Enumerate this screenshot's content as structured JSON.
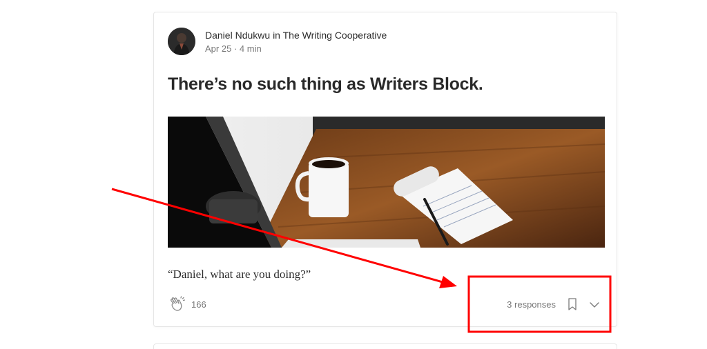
{
  "post": {
    "author": "Daniel Ndukwu",
    "in_word": "in",
    "publication": "The Writing Cooperative",
    "date": "Apr 25",
    "separator": "·",
    "read_time": "4 min",
    "title": "There’s no such thing as Writers Block.",
    "snippet": "“Daniel, what are you doing?”",
    "claps": "166",
    "responses": "3 responses"
  },
  "icons": {
    "clap": "clap-icon",
    "bookmark": "bookmark-icon",
    "chevron": "chevron-down-icon"
  },
  "colors": {
    "annotation": "#ff0000",
    "text_primary": "rgba(0,0,0,0.84)",
    "text_secondary": "rgba(0,0,0,0.54)"
  }
}
